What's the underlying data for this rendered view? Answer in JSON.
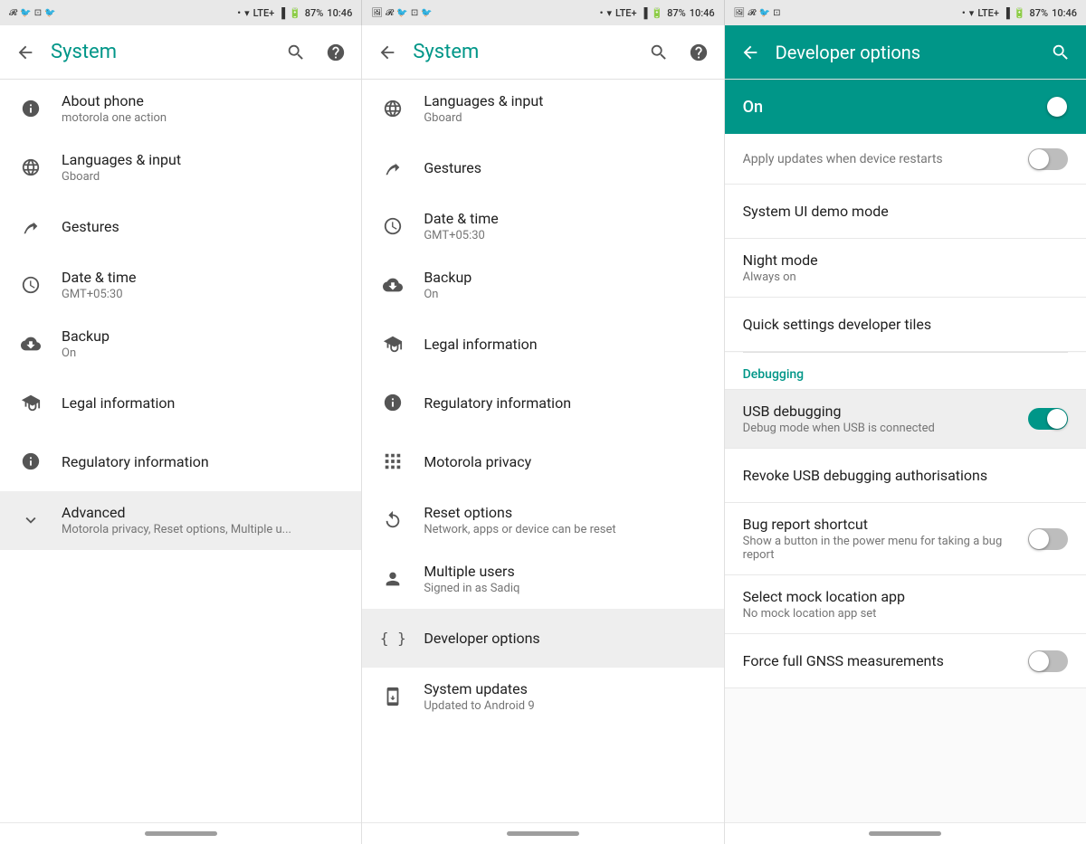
{
  "statusBar": {
    "battery": "87%",
    "time": "10:46",
    "signal": "LTE+"
  },
  "panel1": {
    "title": "System",
    "items": [
      {
        "id": "about-phone",
        "icon": "info",
        "title": "About phone",
        "subtitle": "motorola one action"
      },
      {
        "id": "languages",
        "icon": "globe",
        "title": "Languages & input",
        "subtitle": "Gboard"
      },
      {
        "id": "gestures",
        "icon": "gesture",
        "title": "Gestures",
        "subtitle": ""
      },
      {
        "id": "date-time",
        "icon": "clock",
        "title": "Date & time",
        "subtitle": "GMT+05:30"
      },
      {
        "id": "backup",
        "icon": "backup",
        "title": "Backup",
        "subtitle": "On"
      },
      {
        "id": "legal",
        "icon": "legal",
        "title": "Legal information",
        "subtitle": ""
      },
      {
        "id": "regulatory",
        "icon": "info",
        "title": "Regulatory information",
        "subtitle": ""
      },
      {
        "id": "advanced",
        "icon": "chevron-down",
        "title": "Advanced",
        "subtitle": "Motorola privacy, Reset options, Multiple u...",
        "highlighted": true
      }
    ]
  },
  "panel2": {
    "title": "System",
    "items": [
      {
        "id": "languages",
        "icon": "globe",
        "title": "Languages & input",
        "subtitle": "Gboard"
      },
      {
        "id": "gestures",
        "icon": "gesture",
        "title": "Gestures",
        "subtitle": ""
      },
      {
        "id": "date-time",
        "icon": "clock",
        "title": "Date & time",
        "subtitle": "GMT+05:30"
      },
      {
        "id": "backup",
        "icon": "backup",
        "title": "Backup",
        "subtitle": "On"
      },
      {
        "id": "legal",
        "icon": "legal",
        "title": "Legal information",
        "subtitle": ""
      },
      {
        "id": "regulatory",
        "icon": "info",
        "title": "Regulatory information",
        "subtitle": ""
      },
      {
        "id": "motorola-privacy",
        "icon": "grid",
        "title": "Motorola privacy",
        "subtitle": ""
      },
      {
        "id": "reset-options",
        "icon": "reset",
        "title": "Reset options",
        "subtitle": "Network, apps or device can be reset"
      },
      {
        "id": "multiple-users",
        "icon": "person",
        "title": "Multiple users",
        "subtitle": "Signed in as Sadiq"
      },
      {
        "id": "developer-options",
        "icon": "brackets",
        "title": "Developer options",
        "subtitle": "",
        "highlighted": true
      },
      {
        "id": "system-updates",
        "icon": "system-update",
        "title": "System updates",
        "subtitle": "Updated to Android 9"
      }
    ]
  },
  "panel3": {
    "title": "Developer options",
    "onLabel": "On",
    "applyUpdatesTitle": "Apply updates when device restarts",
    "sections": [
      {
        "items": [
          {
            "id": "system-ui-demo",
            "title": "System UI demo mode",
            "subtitle": "",
            "hasToggle": false
          },
          {
            "id": "night-mode",
            "title": "Night mode",
            "subtitle": "Always on",
            "hasToggle": false
          },
          {
            "id": "quick-settings",
            "title": "Quick settings developer tiles",
            "subtitle": "",
            "hasToggle": false
          }
        ]
      }
    ],
    "debuggingLabel": "Debugging",
    "debuggingItems": [
      {
        "id": "usb-debugging",
        "title": "USB debugging",
        "subtitle": "Debug mode when USB is connected",
        "hasToggle": true,
        "toggleOn": true,
        "highlighted": true
      },
      {
        "id": "revoke-usb",
        "title": "Revoke USB debugging authorisations",
        "subtitle": "",
        "hasToggle": false
      },
      {
        "id": "bug-report",
        "title": "Bug report shortcut",
        "subtitle": "Show a button in the power menu for taking a bug report",
        "hasToggle": true,
        "toggleOn": false
      },
      {
        "id": "mock-location",
        "title": "Select mock location app",
        "subtitle": "No mock location app set",
        "hasToggle": false
      },
      {
        "id": "force-gnss",
        "title": "Force full GNSS measurements",
        "subtitle": "",
        "hasToggle": true,
        "toggleOn": false
      }
    ]
  }
}
